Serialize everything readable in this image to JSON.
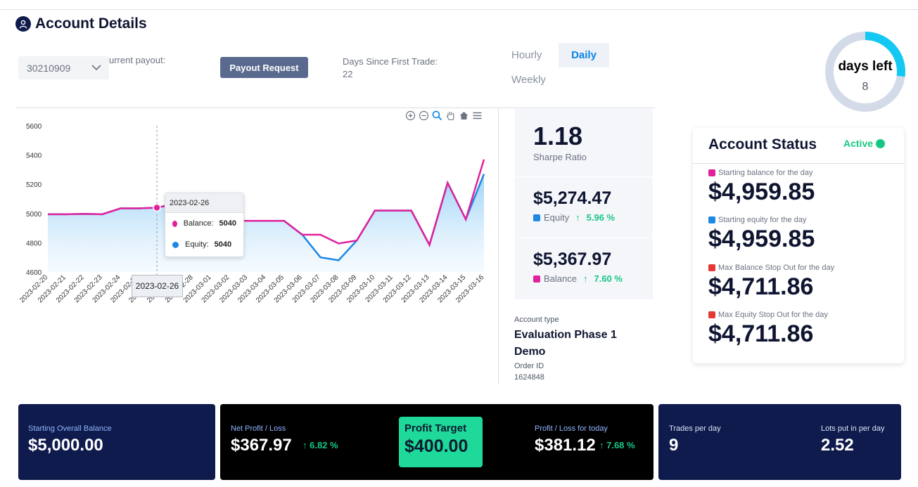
{
  "header": {
    "title": "Account Details"
  },
  "controls": {
    "account_select": "30210909",
    "payout_label": "urrent payout:",
    "payout_button": "Payout Request",
    "days_since_label": "Days Since First Trade:",
    "days_since_value": "22"
  },
  "tabs": [
    {
      "label": "Hourly",
      "active": false
    },
    {
      "label": "Daily",
      "active": true
    },
    {
      "label": "Weekly",
      "active": false
    }
  ],
  "days_left": {
    "label": "days left",
    "value": "8",
    "fraction": 0.27
  },
  "chart_data": {
    "type": "area",
    "x": [
      "2023-02-20",
      "2023-02-21",
      "2023-02-22",
      "2023-02-23",
      "2023-02-24",
      "2023-02-25",
      "2023-02-26",
      "2023-02-27",
      "2023-02-28",
      "2023-03-01",
      "2023-03-02",
      "2023-03-03",
      "2023-03-04",
      "2023-03-05",
      "2023-03-06",
      "2023-03-07",
      "2023-03-08",
      "2023-03-09",
      "2023-03-10",
      "2023-03-11",
      "2023-03-12",
      "2023-03-13",
      "2023-03-14",
      "2023-03-15",
      "2023-03-16"
    ],
    "series": [
      {
        "name": "Balance",
        "color": "#e1209c",
        "values": [
          4995,
          4995,
          4997,
          4995,
          5035,
          5035,
          5040,
          5065,
          5060,
          4960,
          4950,
          4950,
          4950,
          4950,
          4855,
          4855,
          4795,
          4815,
          5020,
          5020,
          5020,
          4785,
          5210,
          4960,
          5370
        ]
      },
      {
        "name": "Equity",
        "color": "#1e88e5",
        "values": [
          4995,
          4995,
          4997,
          4995,
          5035,
          5035,
          5040,
          5065,
          5060,
          4960,
          4950,
          4950,
          4950,
          4950,
          4855,
          4700,
          4680,
          4815,
          5020,
          5020,
          5020,
          4785,
          5210,
          4960,
          5270
        ]
      }
    ],
    "ylim": [
      4600,
      5600
    ],
    "yticks": [
      "4600",
      "4800",
      "5000",
      "5200",
      "5400",
      "5600"
    ],
    "tooltip": {
      "date": "2023-02-26",
      "balance_label": "Balance:",
      "balance": "5040",
      "equity_label": "Equity:",
      "equity": "5040"
    },
    "hover_index": 6
  },
  "metrics": {
    "sharpe": {
      "value": "1.18",
      "label": "Sharpe Ratio"
    },
    "equity": {
      "value": "$5,274.47",
      "label": "Equity",
      "pct": "5.96 %",
      "color": "#1e88e5"
    },
    "balance": {
      "value": "$5,367.97",
      "label": "Balance",
      "pct": "7.60 %",
      "color": "#e1209c"
    }
  },
  "account_info": {
    "type_label": "Account type",
    "type_value": "Evaluation Phase 1 Demo",
    "order_label": "Order ID",
    "order_value": "1624848"
  },
  "status": {
    "title": "Account Status",
    "badge": "Active",
    "items": [
      {
        "label": "Starting balance for the day",
        "value": "$4,959.85",
        "color": "#e1209c"
      },
      {
        "label": "Starting equity for the day",
        "value": "$4,959.85",
        "color": "#1e88e5"
      },
      {
        "label": "Max Balance Stop Out for the day",
        "value": "$4,711.86",
        "color": "#e53935"
      },
      {
        "label": "Max Equity Stop Out for the day",
        "value": "$4,711.86",
        "color": "#e53935"
      }
    ]
  },
  "bottom": {
    "starting_label": "Starting Overall Balance",
    "starting_value": "$5,000.00",
    "net_label": "Net Profit / Loss",
    "net_value": "$367.97",
    "net_pct": "↑ 6.82 %",
    "target_label": "Profit Target",
    "target_value": "$400.00",
    "today_label": "Profit / Loss for today",
    "today_value": "$381.12",
    "today_pct": "↑ 7.68 %",
    "trades_label": "Trades per day",
    "trades_value": "9",
    "lots_label": "Lots put in per day",
    "lots_value": "2.52"
  }
}
